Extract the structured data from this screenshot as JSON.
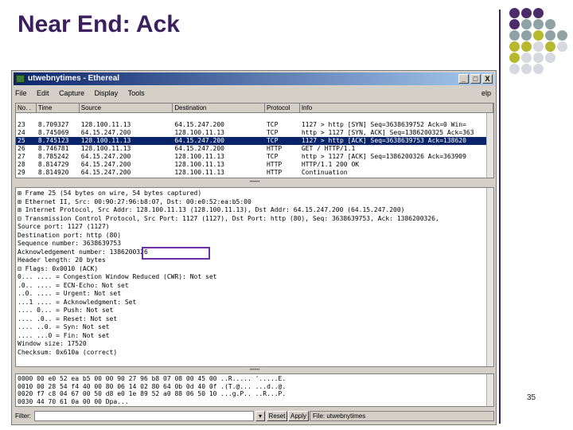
{
  "slide": {
    "title": "Near End: Ack",
    "page_number": "35",
    "accent_colors": [
      "#4a2c6b",
      "#8fa3a6",
      "#b8b82e",
      "#d8d8e0"
    ]
  },
  "window": {
    "title": "utwebnytimes - Ethereal",
    "minimize": "_",
    "maximize": "□",
    "close": "X",
    "menu": [
      "File",
      "Edit",
      "Capture",
      "Display",
      "Tools"
    ],
    "help": "elp"
  },
  "packet_list": {
    "columns": [
      "No. .",
      "Time",
      "Source",
      "Destination",
      "Protocol",
      "Info"
    ],
    "rows": [
      {
        "no": "",
        "time": "",
        "src": "",
        "dst": "",
        "proto": "",
        "info": ""
      },
      {
        "no": "23",
        "time": "8.709327",
        "src": "128.100.11.13",
        "dst": "64.15.247.200",
        "proto": "TCP",
        "info": "1127 > http [SYN] Seq=3638639752 Ack=0 Win="
      },
      {
        "no": "24",
        "time": "8.745069",
        "src": "64.15.247.200",
        "dst": "128.100.11.13",
        "proto": "TCP",
        "info": "http > 1127 [SYN, ACK] Seq=1386200325 Ack=363"
      },
      {
        "no": "25",
        "time": "8.745123",
        "src": "128.100.11.13",
        "dst": "64.15.247.200",
        "proto": "TCP",
        "info": "1127 > http [ACK] Seq=3638639753 Ack=138620"
      },
      {
        "no": "26",
        "time": "8.746781",
        "src": "128.100.11.13",
        "dst": "64.15.247.200",
        "proto": "HTTP",
        "info": "GET / HTTP/1.1"
      },
      {
        "no": "27",
        "time": "8.785242",
        "src": "64.15.247.200",
        "dst": "128.100.11.13",
        "proto": "TCP",
        "info": "http > 1127 [ACK] Seq=1386200326 Ack=363909"
      },
      {
        "no": "28",
        "time": "8.814729",
        "src": "64.15.247.200",
        "dst": "128.100.11.13",
        "proto": "HTTP",
        "info": "HTTP/1.1 200 OK"
      },
      {
        "no": "29",
        "time": "8.814920",
        "src": "64.15.247.200",
        "dst": "128.100.11.13",
        "proto": "HTTP",
        "info": "Continuation"
      }
    ]
  },
  "detail": [
    "⊞ Frame 25 (54 bytes on wire, 54 bytes captured)",
    "⊞ Ethernet II, Src: 00:90:27:96:b8:07, Dst: 00:e0:52:ea:b5:00",
    "⊞ Internet Protocol, Src Addr: 128.100.11.13 (128.100.11.13), Dst Addr: 64.15.247.200 (64.15.247.200)",
    "⊟ Transmission Control Protocol, Src Port: 1127 (1127), Dst Port: http (80), Seq: 3638639753, Ack: 1386200326,",
    "     Source port: 1127 (1127)",
    "     Destination port: http (80)",
    "     Sequence number: 3638639753",
    "     Acknowledgement number: 1386200326",
    "     Header length: 20 bytes",
    "   ⊟ Flags: 0x0010 (ACK)",
    "        0... .... = Congestion Window Reduced (CWR): Not set",
    "        .0.. .... = ECN-Echo: Not set",
    "        ..0. .... = Urgent: Not set",
    "        ...1 .... = Acknowledgment: Set",
    "        .... 0... = Push: Not set",
    "        .... .0.. = Reset: Not set",
    "        .... ..0. = Syn: Not set",
    "        .... ...0 = Fin: Not set",
    "     Window size: 17520",
    "     Checksum: 0x610a (correct)"
  ],
  "hex": [
    "0000  00 e0 52 ea b5 00 00 90  27 96 b8 07 08 00 45 00   ..R..... '.....E.",
    "0010  00 28 54 f4 40 00 80 06  14 02 80 64 0b 0d 40 0f   .(T.@... ...d..@.",
    "0020  f7 c8 04 67 00 50 d8 e0  1e 89 52 a0 88 06 50 10   ...g.P.. ..R...P.",
    "0030  44 70 61 0a 00 00                                  Dpa..."
  ],
  "statusbar": {
    "filter_label": "Filter:",
    "filter_value": "",
    "reset": "Reset",
    "apply": "Apply",
    "status": "File: utwebnytimes"
  }
}
